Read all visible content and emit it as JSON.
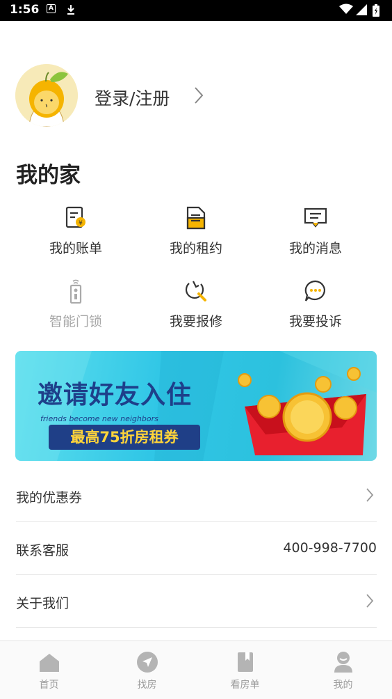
{
  "status_bar": {
    "time": "1:56",
    "a_icon_label": "A"
  },
  "profile": {
    "login_label": "登录/注册"
  },
  "my_home": {
    "title": "我的家",
    "items": [
      {
        "label": "我的账单",
        "icon": "bill-icon",
        "enabled": true
      },
      {
        "label": "我的租约",
        "icon": "contract-icon",
        "enabled": true
      },
      {
        "label": "我的消息",
        "icon": "message-icon",
        "enabled": true
      },
      {
        "label": "智能门锁",
        "icon": "smart-lock-icon",
        "enabled": false
      },
      {
        "label": "我要报修",
        "icon": "repair-icon",
        "enabled": true
      },
      {
        "label": "我要投诉",
        "icon": "complaint-icon",
        "enabled": true
      }
    ]
  },
  "banner": {
    "title": "邀请好友入住",
    "subtitle": "friends become new neighbors",
    "tag": "最高75折房租券",
    "slides": 2,
    "active_slide": 0
  },
  "list": [
    {
      "label": "我的优惠券",
      "value": ""
    },
    {
      "label": "联系客服",
      "value": "400-998-7700"
    },
    {
      "label": "关于我们",
      "value": ""
    }
  ],
  "tabs": [
    {
      "label": "首页",
      "icon": "home-icon"
    },
    {
      "label": "找房",
      "icon": "navigation-icon"
    },
    {
      "label": "看房单",
      "icon": "bookmark-icon"
    },
    {
      "label": "我的",
      "icon": "user-icon"
    }
  ],
  "colors": {
    "accent": "#f5b400",
    "banner_blue": "#1f3f87",
    "banner_yellow": "#ffd43a",
    "tab_inactive": "#9a9a9a"
  }
}
